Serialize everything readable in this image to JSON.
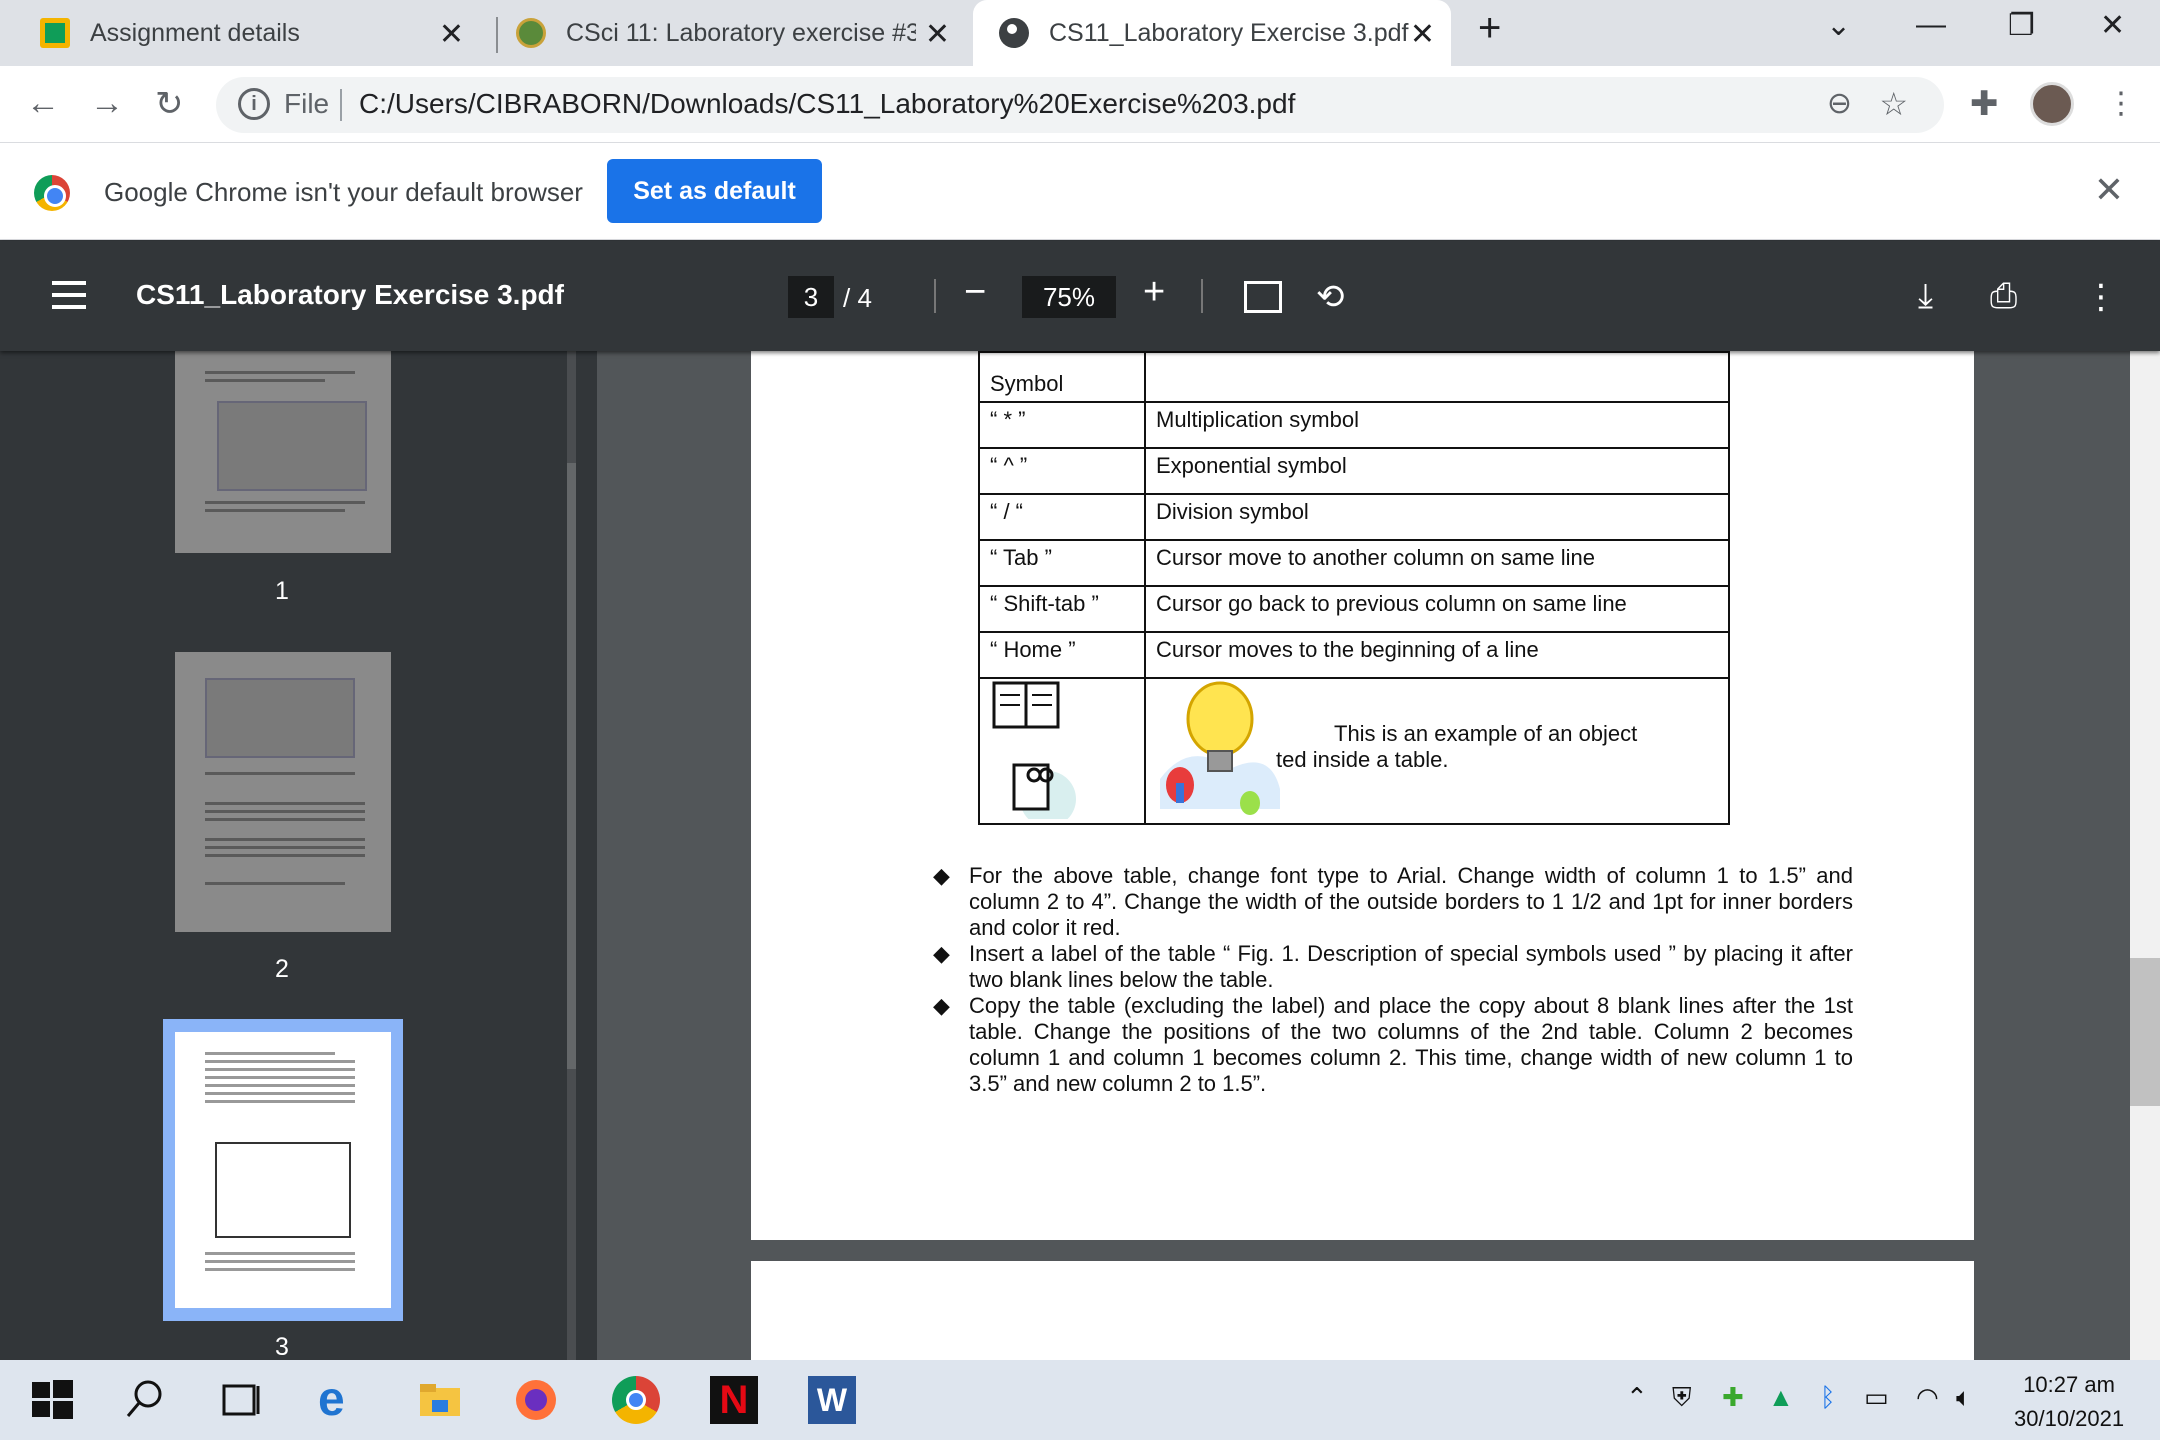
{
  "tabs": [
    {
      "label": "Assignment details"
    },
    {
      "label": "CSci 11: Laboratory exercise #3 -"
    },
    {
      "label": "CS11_Laboratory Exercise 3.pdf"
    }
  ],
  "new_tab_symbol": "+",
  "address": {
    "file_label": "File",
    "url": "C:/Users/CIBRABORN/Downloads/CS11_Laboratory%20Exercise%203.pdf"
  },
  "infobar": {
    "message": "Google Chrome isn't your default browser",
    "button": "Set as default"
  },
  "pdf": {
    "title": "CS11_Laboratory Exercise 3.pdf",
    "current_page": "3",
    "total_pages": "/ 4",
    "zoom": "75%"
  },
  "thumbnails": [
    {
      "label": "1"
    },
    {
      "label": "2"
    },
    {
      "label": "3"
    }
  ],
  "table": {
    "header_symbol": "Symbol",
    "rows": [
      {
        "key": "“ * ”",
        "desc": "Multiplication symbol"
      },
      {
        "key": "“ ^ ”",
        "desc": "Exponential symbol"
      },
      {
        "key": "“ / “",
        "desc": "Division symbol"
      },
      {
        "key": "“ Tab ”",
        "desc": "Cursor move to another column on same line"
      },
      {
        "key": "“ Shift-tab ”",
        "desc": "Cursor go back to previous column on same line"
      },
      {
        "key": "“ Home ”",
        "desc": "Cursor moves to the beginning of a line"
      }
    ],
    "object_text_1": "This is an example of an object",
    "object_text_2": "ted inside a table."
  },
  "bullets": [
    "For the above table, change font type to Arial. Change width of column 1 to 1.5” and column 2 to 4”. Change the width of the outside borders to 1 1/2 and 1pt for inner borders and color it red.",
    "Insert a label of the table “ Fig. 1. Description of special symbols used ” by placing it after two blank lines below the table.",
    "Copy the table (excluding the label) and place the copy about 8 blank lines after the 1st table. Change the positions of the two columns of the 2nd table. Column 2 becomes column 1 and column 1 becomes column 2. This time, change width of new column 1 to 3.5” and new column 2 to 1.5”."
  ],
  "clock": {
    "time": "10:27 am",
    "date": "30/10/2021"
  },
  "colors": {
    "accent": "#1a73e8",
    "pdf_toolbar": "#323639",
    "viewer_bg": "#525659",
    "thumb_selected": "#8ab4f8"
  }
}
